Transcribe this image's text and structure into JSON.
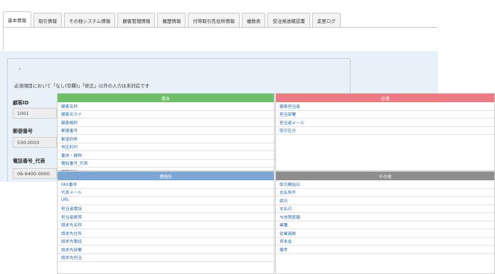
{
  "tabs": [
    {
      "label": "基本情報",
      "active": true
    },
    {
      "label": "取引情報",
      "active": false
    },
    {
      "label": "その他システム情報",
      "active": false
    },
    {
      "label": "顧客管理情報",
      "active": false
    },
    {
      "label": "履歴情報",
      "active": false
    },
    {
      "label": "付帯取引先住所情報",
      "active": false
    },
    {
      "label": "複数表",
      "active": false
    },
    {
      "label": "受注発送確認書",
      "active": false
    },
    {
      "label": "変更ログ",
      "active": false
    }
  ],
  "form": {
    "collapse_symbol": "˅",
    "instruction": "必須項目において「なし(空欄)」「修正」以外の入力は未対応です",
    "fields": [
      {
        "label": "顧客ID",
        "value": "1001"
      },
      {
        "label": "郵便番号",
        "value": "530-0003"
      },
      {
        "label": "電話番号_代表",
        "value": "06-6400-0000"
      }
    ]
  },
  "panels": {
    "green": {
      "title": "基本",
      "color": "#6dbf67",
      "items": [
        "顧客名称",
        "顧客名カナ",
        "顧客略称",
        "郵便番号",
        "都道府県",
        "市区町村",
        "番地・建物",
        "電話番号_代表",
        "顧客区分"
      ]
    },
    "red": {
      "title": "必須",
      "color": "#ee7a84",
      "items": [
        "顧客担当者",
        "担当部署",
        "担当者メール",
        "取引区分"
      ]
    },
    "blue": {
      "title": "連絡先",
      "color": "#7ba7d7",
      "items": [
        "FAX番号",
        "代表メール",
        "URL",
        "担当者電話",
        "担当者携帯",
        "請求先名称",
        "請求先住所",
        "請求先電話",
        "請求先部署",
        "請求先担当"
      ]
    },
    "gray": {
      "title": "その他",
      "color": "#8e8e8e",
      "items": [
        "取引開始日",
        "支払条件",
        "締日",
        "支払日",
        "与信限度額",
        "業種",
        "従業員数",
        "資本金",
        "備考"
      ]
    }
  }
}
